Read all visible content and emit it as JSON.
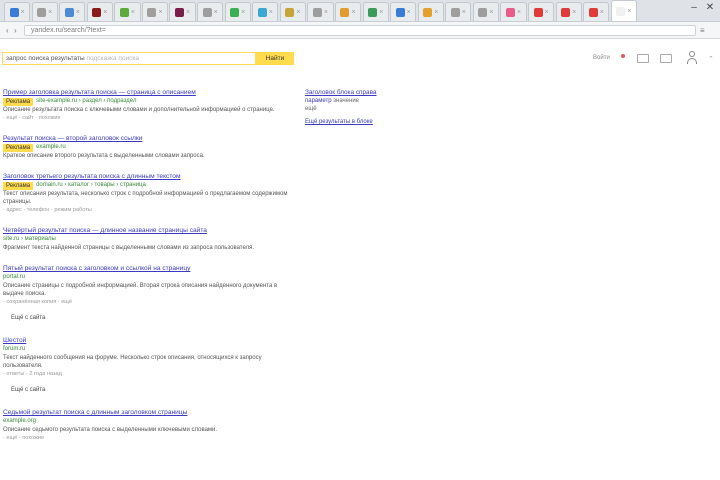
{
  "browser": {
    "tabs": [
      {
        "favicon": "#3a7bd5",
        "label": ""
      },
      {
        "favicon": "#9e9e9e",
        "label": ""
      },
      {
        "favicon": "#4b8bd4",
        "label": ""
      },
      {
        "favicon": "#8b1a1a",
        "label": ""
      },
      {
        "favicon": "#5aaa3c",
        "label": ""
      },
      {
        "favicon": "#9e9e9e",
        "label": ""
      },
      {
        "favicon": "#7a1d4a",
        "label": ""
      },
      {
        "favicon": "#9e9e9e",
        "label": ""
      },
      {
        "favicon": "#3caf50",
        "label": ""
      },
      {
        "favicon": "#3ca7d5",
        "label": ""
      },
      {
        "favicon": "#c6a43a",
        "label": ""
      },
      {
        "favicon": "#9e9e9e",
        "label": ""
      },
      {
        "favicon": "#e39a2e",
        "label": ""
      },
      {
        "favicon": "#3c9b5b",
        "label": ""
      },
      {
        "favicon": "#3a7bd5",
        "label": ""
      },
      {
        "favicon": "#e3a12e",
        "label": ""
      },
      {
        "favicon": "#9e9e9e",
        "label": ""
      },
      {
        "favicon": "#9e9e9e",
        "label": ""
      },
      {
        "favicon": "#e85c8a",
        "label": ""
      },
      {
        "favicon": "#e03b3b",
        "label": ""
      },
      {
        "favicon": "#e03b3b",
        "label": ""
      },
      {
        "favicon": "#e03b3b",
        "label": ""
      },
      {
        "favicon": "#f0f0f0",
        "label": ""
      }
    ],
    "active_tab": 23,
    "url": "yandex.ru/search/?text=",
    "window_min": "–",
    "window_close": "✕"
  },
  "search": {
    "query": "запрос поиска результаты",
    "ghost": "подсказка поиска",
    "button_label": "Найти"
  },
  "header": {
    "notify_text": "Войти",
    "accent": "#ffdb4d"
  },
  "results": [
    {
      "title": "Пример заголовка результата поиска — страница с описанием",
      "badge": "Реклама",
      "url": "site-example.ru › раздел › подраздел",
      "snippet": "Описание результата поиска с ключевыми словами и дополнительной информацией о странице.",
      "meta": "· ещё · сайт · похожие",
      "more": ""
    },
    {
      "title": "Результат поиска — второй заголовок ссылки",
      "badge": "Реклама",
      "url": "example.ru",
      "snippet": "Краткое описание второго результата с выделенными словами запроса.",
      "meta": "",
      "more": ""
    },
    {
      "title": "Заголовок третьего результата поиска с длинным текстом",
      "badge": "Реклама",
      "url": "domain.ru › каталог › товары › страница",
      "snippet": "Текст описания результата, несколько строк с подробной информацией о предлагаемом содержимом страницы.",
      "meta": "· адрес · телефон · режим работы",
      "more": ""
    },
    {
      "title": "Четвёртый результат поиска — длинное название страницы сайта",
      "badge": "",
      "url": "site.ru › материалы",
      "snippet": "Фрагмент текста найденной страницы с выделенными словами из запроса пользователя.",
      "meta": "",
      "more": ""
    },
    {
      "title": "Пятый результат поиска с заголовком и ссылкой на страницу",
      "badge": "",
      "url": "portal.ru",
      "snippet": "Описание страницы с подробной информацией. Вторая строка описания найденного документа в выдаче поиска.",
      "meta": "· сохранённая копия · ещё",
      "more": "Ещё с сайта"
    },
    {
      "title": "Шестой",
      "badge": "",
      "url": "forum.ru",
      "snippet": "Текст найденного сообщения на форуме. Несколько строк описания, относящихся к запросу пользователя.",
      "meta": "· ответы · 2 года назад",
      "more": "Ещё с сайта"
    },
    {
      "title": "Седьмой результат поиска с длинным заголовком страницы",
      "badge": "",
      "url": "example.org",
      "snippet": "Описание седьмого результата поиска с выделенными ключевыми словами.",
      "meta": "· ещё · похожие",
      "more": ""
    }
  ],
  "right_panel": {
    "title": "Заголовок блока справа",
    "rows": [
      {
        "label": "параметр",
        "value": "значение"
      },
      {
        "label": "ещё",
        "value": ""
      }
    ],
    "link": "Ещё результаты в блоке"
  }
}
